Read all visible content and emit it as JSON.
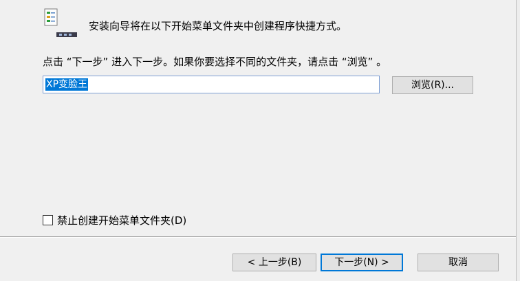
{
  "header": {
    "icon": "start-menu-shortcut-icon",
    "text": "安装向导将在以下开始菜单文件夹中创建程序快捷方式。"
  },
  "instruction": "点击 “下一步” 进入下一步。如果你要选择不同的文件夹，请点击 “浏览” 。",
  "folder_input": {
    "value": "XP变脸王"
  },
  "browse_button": "浏览(R)...",
  "no_folder_checkbox": {
    "label": "禁止创建开始菜单文件夹(D)",
    "checked": false
  },
  "nav": {
    "back": "< 上一步(B)",
    "next": "下一步(N) >",
    "cancel": "取消"
  },
  "colors": {
    "accent": "#0078d7",
    "background": "#f0f0f0"
  }
}
